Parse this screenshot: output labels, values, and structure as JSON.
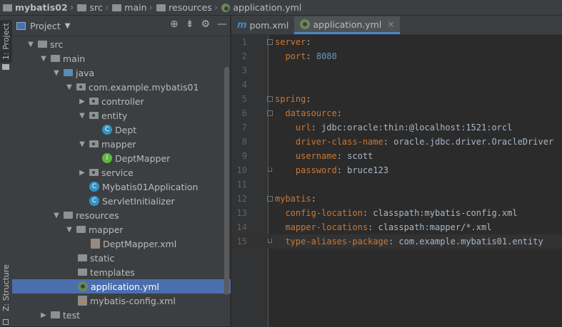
{
  "breadcrumb": {
    "items": [
      "mybatis02",
      "src",
      "main",
      "resources",
      "application.yml"
    ]
  },
  "left_strip": {
    "project_tab": "1: Project",
    "structure_tab": "Z: Structure"
  },
  "project_panel": {
    "title": "Project",
    "tree": [
      {
        "label": "src",
        "type": "folder"
      },
      {
        "label": "main",
        "type": "folder"
      },
      {
        "label": "java",
        "type": "folder-blue"
      },
      {
        "label": "com.example.mybatis01",
        "type": "package"
      },
      {
        "label": "controller",
        "type": "package"
      },
      {
        "label": "entity",
        "type": "package"
      },
      {
        "label": "Dept",
        "type": "class"
      },
      {
        "label": "mapper",
        "type": "package"
      },
      {
        "label": "DeptMapper",
        "type": "interface"
      },
      {
        "label": "service",
        "type": "package"
      },
      {
        "label": "Mybatis01Application",
        "type": "class"
      },
      {
        "label": "ServletInitializer",
        "type": "class"
      },
      {
        "label": "resources",
        "type": "folder"
      },
      {
        "label": "mapper",
        "type": "folder"
      },
      {
        "label": "DeptMapper.xml",
        "type": "xml"
      },
      {
        "label": "static",
        "type": "folder"
      },
      {
        "label": "templates",
        "type": "folder"
      },
      {
        "label": "application.yml",
        "type": "yml"
      },
      {
        "label": "mybatis-config.xml",
        "type": "xml"
      },
      {
        "label": "test",
        "type": "folder"
      }
    ]
  },
  "editor": {
    "tabs": [
      {
        "label": "pom.xml"
      },
      {
        "label": "application.yml"
      }
    ],
    "lines": [
      {
        "num": "1",
        "key": "server",
        "val": ""
      },
      {
        "num": "2",
        "key": "  port",
        "val": "8080"
      },
      {
        "num": "3",
        "key": "",
        "val": ""
      },
      {
        "num": "4",
        "key": "",
        "val": ""
      },
      {
        "num": "5",
        "key": "spring",
        "val": ""
      },
      {
        "num": "6",
        "key": "  datasource",
        "val": ""
      },
      {
        "num": "7",
        "key": "    url",
        "val": "jdbc:oracle:thin:@localhost:1521:orcl"
      },
      {
        "num": "8",
        "key": "    driver-class-name",
        "val": "oracle.jdbc.driver.OracleDriver"
      },
      {
        "num": "9",
        "key": "    username",
        "val": "scott"
      },
      {
        "num": "10",
        "key": "    password",
        "val": "bruce123"
      },
      {
        "num": "11",
        "key": "",
        "val": ""
      },
      {
        "num": "12",
        "key": "mybatis",
        "val": ""
      },
      {
        "num": "13",
        "key": "  config-location",
        "val": "classpath:mybatis-config.xml"
      },
      {
        "num": "14",
        "key": "  mapper-locations",
        "val": "classpath:mapper/*.xml"
      },
      {
        "num": "15",
        "key": "  type-aliases-package",
        "val": "com.example.mybatis01.entity"
      },
      {
        "num": "",
        "key": "",
        "val": ""
      }
    ]
  }
}
